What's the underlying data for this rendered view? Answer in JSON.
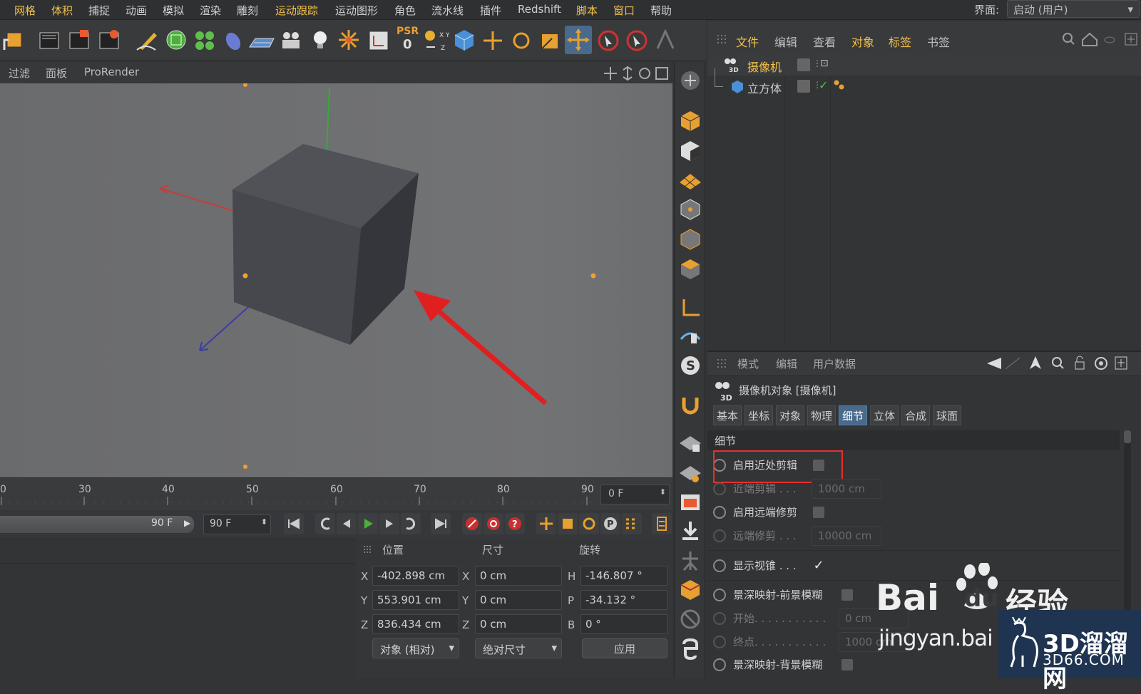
{
  "menubar": {
    "items": [
      {
        "label": "网格",
        "hl": true
      },
      {
        "label": "体积",
        "hl": true
      },
      {
        "label": "捕捉",
        "hl": false
      },
      {
        "label": "动画",
        "hl": false
      },
      {
        "label": "模拟",
        "hl": false
      },
      {
        "label": "渲染",
        "hl": false
      },
      {
        "label": "雕刻",
        "hl": false
      },
      {
        "label": "运动跟踪",
        "hl": true
      },
      {
        "label": "运动图形",
        "hl": false
      },
      {
        "label": "角色",
        "hl": false
      },
      {
        "label": "流水线",
        "hl": false
      },
      {
        "label": "插件",
        "hl": false
      },
      {
        "label": "Redshift",
        "hl": false
      },
      {
        "label": "脚本",
        "hl": true
      },
      {
        "label": "窗口",
        "hl": true
      },
      {
        "label": "帮助",
        "hl": false
      }
    ],
    "interface_label": "界面:",
    "interface_value": "启动 (用户)"
  },
  "toolbar": {
    "psr_label": "PSR",
    "psr_value": "0"
  },
  "viewport": {
    "menu": [
      "过滤",
      "面板",
      "ProRender"
    ]
  },
  "timeline": {
    "ticks": [
      "0",
      "30",
      "40",
      "50",
      "60",
      "70",
      "80",
      "90"
    ],
    "current_frame": "0 F",
    "range_end": "90 F",
    "end_frame": "90 F"
  },
  "coords": {
    "headers": {
      "position": "位置",
      "size": "尺寸",
      "rotation": "旋转"
    },
    "pos_axes": [
      "X",
      "Y",
      "Z"
    ],
    "rot_axes": [
      "H",
      "P",
      "B"
    ],
    "position": [
      "-402.898 cm",
      "553.901 cm",
      "836.434 cm"
    ],
    "size": [
      "0 cm",
      "0 cm",
      "0 cm"
    ],
    "rotation": [
      "-146.807 °",
      "-34.132 °",
      "0 °"
    ],
    "mode": "对象 (相对)",
    "size_mode": "绝对尺寸",
    "apply": "应用"
  },
  "object_manager": {
    "menu": [
      {
        "label": "文件",
        "hl": true
      },
      {
        "label": "编辑",
        "hl": false
      },
      {
        "label": "查看",
        "hl": false
      },
      {
        "label": "对象",
        "hl": true
      },
      {
        "label": "标签",
        "hl": true
      },
      {
        "label": "书签",
        "hl": false
      }
    ],
    "objects": [
      {
        "name": "摄像机",
        "selected": true
      },
      {
        "name": "立方体",
        "selected": false
      }
    ]
  },
  "attributes": {
    "menu": [
      "模式",
      "编辑",
      "用户数据"
    ],
    "title": "摄像机对象 [摄像机]",
    "tabs": [
      {
        "label": "基本",
        "active": false
      },
      {
        "label": "坐标",
        "active": false
      },
      {
        "label": "对象",
        "active": false
      },
      {
        "label": "物理",
        "active": false
      },
      {
        "label": "细节",
        "active": true
      },
      {
        "label": "立体",
        "active": false
      },
      {
        "label": "合成",
        "active": false
      },
      {
        "label": "球面",
        "active": false
      }
    ],
    "section": "细节",
    "props": [
      {
        "label": "启用近处剪辑",
        "checked": false,
        "dim": false
      },
      {
        "label": "近端剪辑 . . .",
        "value": "1000 cm",
        "dim": true
      },
      {
        "label": "启用远端修剪",
        "checked": false,
        "dim": false
      },
      {
        "label": "远端修剪 . . .",
        "value": "10000 cm",
        "dim": true
      },
      {
        "label": "显示视锥 . . .",
        "checked": true,
        "dim": false
      },
      {
        "label": "景深映射-前景模糊",
        "checked": false,
        "dim": false
      },
      {
        "label": "开始. . . . . . . . . . .",
        "value": "0 cm",
        "dim": true
      },
      {
        "label": "终点. . . . . . . . . . .",
        "value": "1000 cm",
        "dim": true
      },
      {
        "label": "景深映射-背景模糊",
        "checked": false,
        "dim": false
      }
    ]
  },
  "watermarks": {
    "baidu": "Bai",
    "baidu_du": "du",
    "baidu_jy": "经验",
    "jingyan": "jingyan.bai",
    "site_name": "3D溜溜网",
    "site_url": "3D66.COM"
  }
}
